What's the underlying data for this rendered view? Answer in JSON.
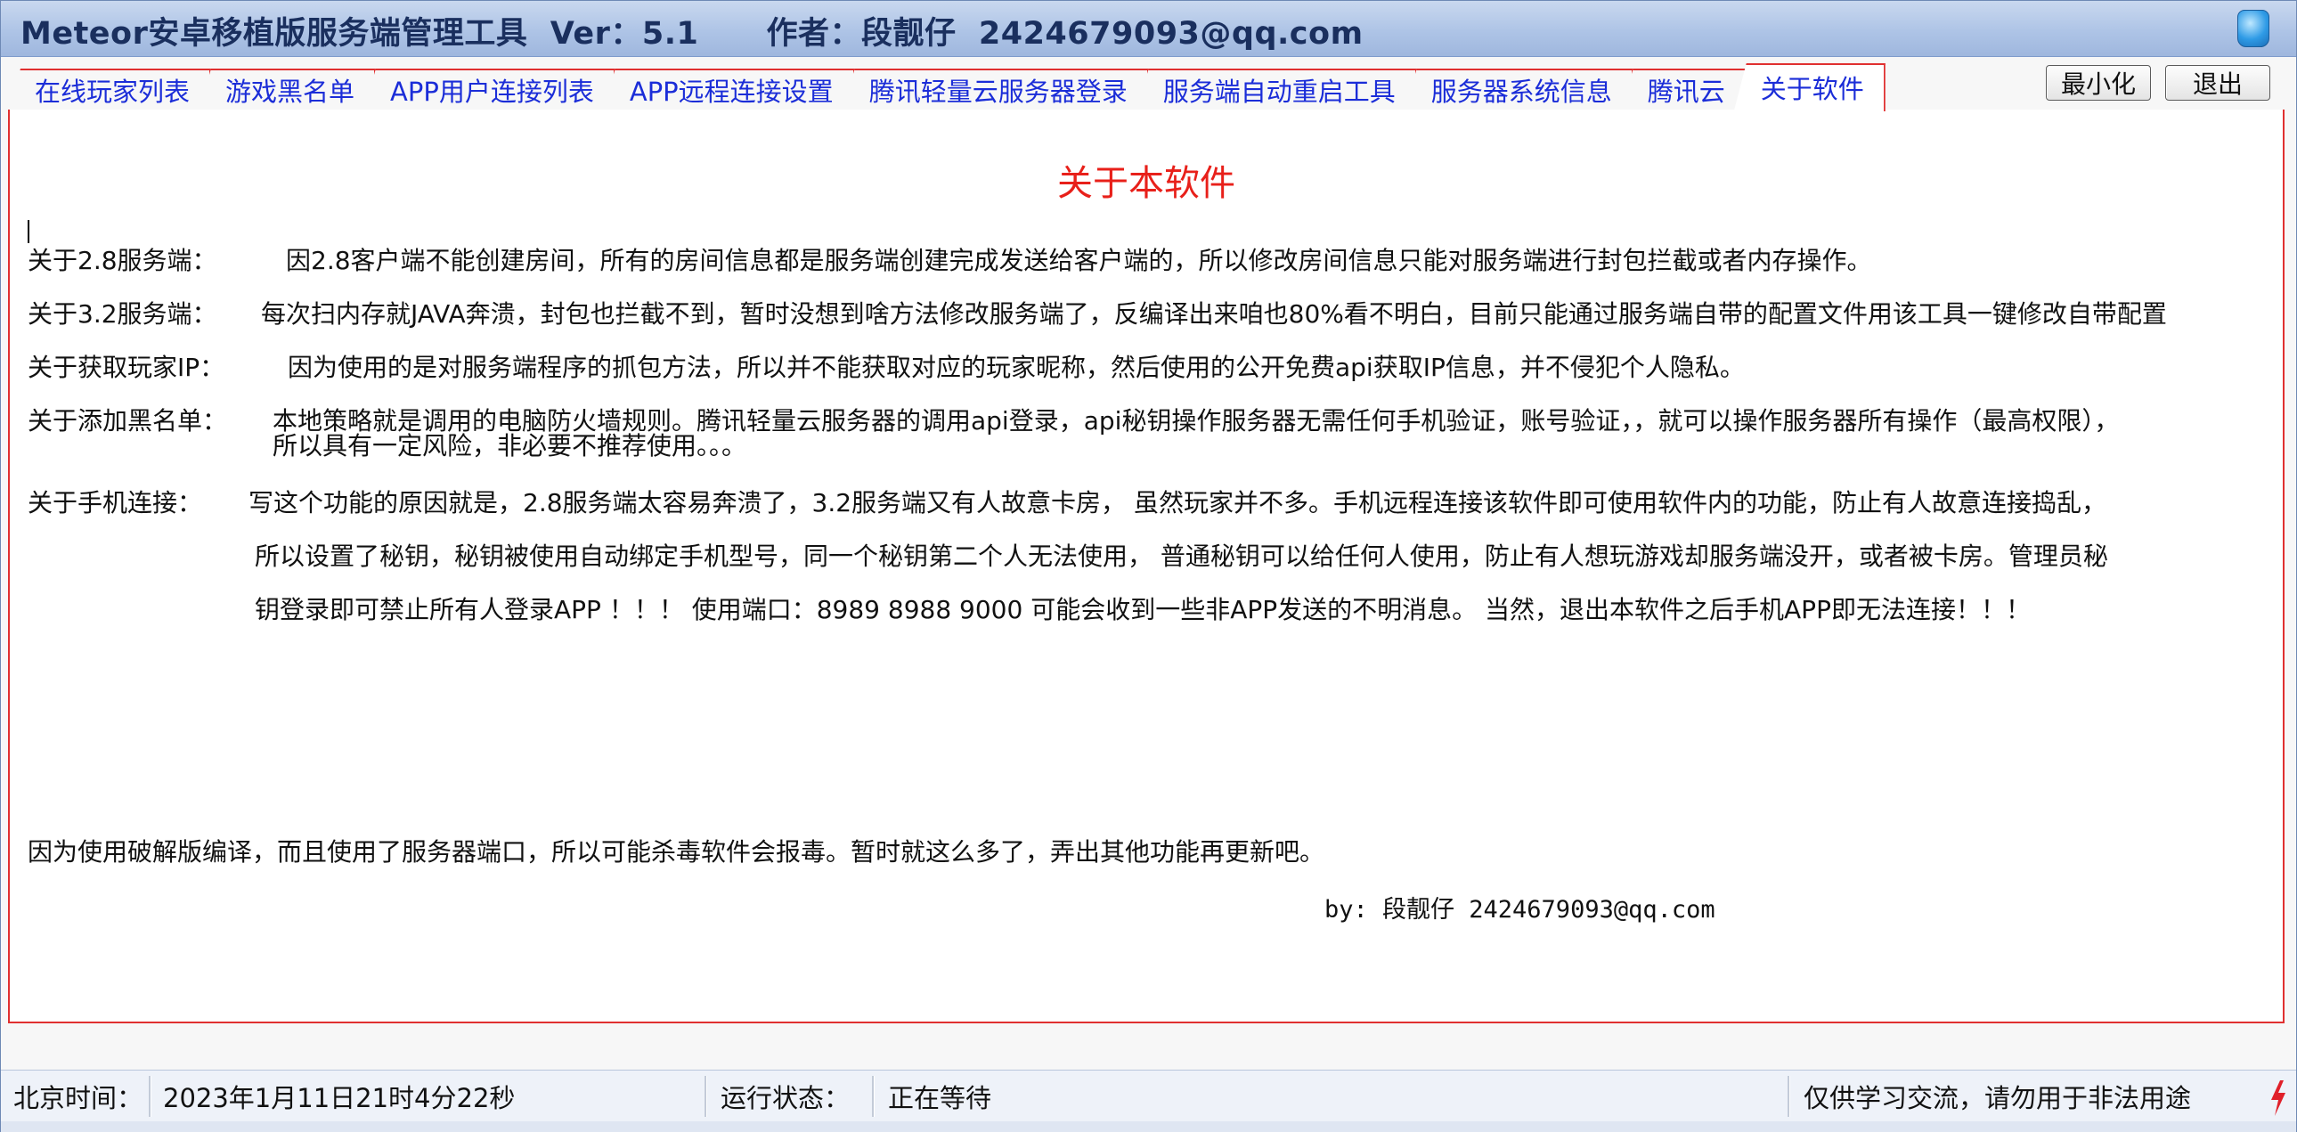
{
  "window": {
    "title": "Meteor安卓移植版服务端管理工具  Ver：5.1      作者：段靓仔  2424679093@qq.com",
    "icon": "app-shield-icon"
  },
  "tabs": [
    {
      "label": "在线玩家列表",
      "active": false
    },
    {
      "label": "游戏黑名单",
      "active": false
    },
    {
      "label": "APP用户连接列表",
      "active": false
    },
    {
      "label": "APP远程连接设置",
      "active": false
    },
    {
      "label": "腾讯轻量云服务器登录",
      "active": false
    },
    {
      "label": "服务端自动重启工具",
      "active": false
    },
    {
      "label": "服务器系统信息",
      "active": false
    },
    {
      "label": "腾讯云",
      "active": false
    },
    {
      "label": "关于软件",
      "active": true
    }
  ],
  "buttons": {
    "minimize": "最小化",
    "exit": "退出"
  },
  "about": {
    "title": "关于本软件",
    "items": [
      {
        "label": "关于2.8服务端：",
        "text": "因2.8客户端不能创建房间，所有的房间信息都是服务端创建完成发送给客户端的，所以修改房间信息只能对服务端进行封包拦截或者内存操作。"
      },
      {
        "label": "关于3.2服务端：",
        "text": "每次扫内存就JAVA奔溃，封包也拦截不到，暂时没想到啥方法修改服务端了，反编译出来咱也80%看不明白，目前只能通过服务端自带的配置文件用该工具一键修改自带配置"
      },
      {
        "label": "关于获取玩家IP：",
        "text": "因为使用的是对服务端程序的抓包方法，所以并不能获取对应的玩家昵称，然后使用的公开免费api获取IP信息，并不侵犯个人隐私。"
      },
      {
        "label": "关于添加黑名单：",
        "text": "本地策略就是调用的电脑防火墙规则。腾讯轻量云服务器的调用api登录，api秘钥操作服务器无需任何手机验证，账号验证，，就可以操作服务器所有操作（最高权限），",
        "cont": "所以具有一定风险，非必要不推荐使用。。。"
      },
      {
        "label": "关于手机连接：",
        "text": "写这个功能的原因就是，2.8服务端太容易奔溃了，3.2服务端又有人故意卡房，  虽然玩家并不多。手机远程连接该软件即可使用软件内的功能，防止有人故意连接捣乱，",
        "cont1": "所以设置了秘钥，秘钥被使用自动绑定手机型号，同一个秘钥第二个人无法使用，    普通秘钥可以给任何人使用，防止有人想玩游戏却服务端没开，或者被卡房。管理员秘",
        "cont2": "钥登录即可禁止所有人登录APP ！！！ 使用端口：8989  8988 9000  可能会收到一些非APP发送的不明消息。     当然，退出本软件之后手机APP即无法连接！！！"
      }
    ],
    "note": "因为使用破解版编译，而且使用了服务器端口，所以可能杀毒软件会报毒。暂时就这么多了，弄出其他功能再更新吧。",
    "signature": "by:  段靓仔 2424679093@qq.com"
  },
  "status": {
    "time_label": "北京时间：",
    "time_value": "2023年1月11日21时4分22秒",
    "run_label": "运行状态：",
    "run_value": "正在等待",
    "notice": "仅供学习交流，请勿用于非法用途"
  },
  "colors": {
    "accent_red": "#e03030",
    "tab_text": "#1b2dd8",
    "title_red": "#e8201a",
    "titlebar": "#aec4e6"
  }
}
